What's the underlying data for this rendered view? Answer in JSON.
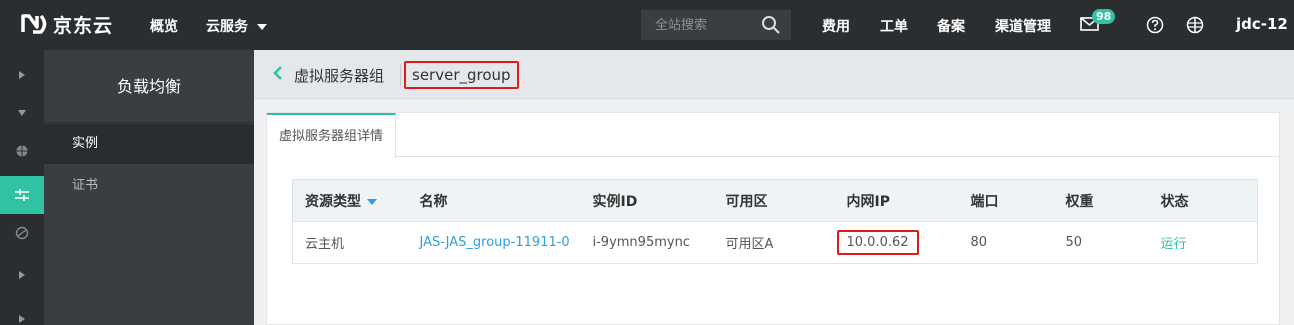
{
  "topbar": {
    "logo_text": "京东云",
    "nav": {
      "overview": "概览",
      "cloud_services": "云服务"
    },
    "search": {
      "placeholder": "全站搜索"
    },
    "links": {
      "billing": "费用",
      "tickets": "工单",
      "filing": "备案",
      "channel": "渠道管理"
    },
    "mail_badge": "98",
    "user": "jdc-12",
    "colors": {
      "background": "#2b2e31",
      "accent": "#2fc2a3"
    }
  },
  "rail": {
    "icons": [
      "chevron-right-icon",
      "chevron-down-icon",
      "globe-icon",
      "load-balancer-icon",
      "network-icon",
      "chevron-right-icon",
      "chevron-right-icon"
    ]
  },
  "sidebar": {
    "title": "负载均衡",
    "items": [
      {
        "label": "实例",
        "active": true
      },
      {
        "label": "证书",
        "active": false
      }
    ]
  },
  "breadcrumb": {
    "label": "虚拟服务器组",
    "name": "server_group"
  },
  "tabs": [
    {
      "label": "虚拟服务器组详情",
      "active": true
    }
  ],
  "table": {
    "headers": {
      "resource_type": "资源类型",
      "name": "名称",
      "instance_id": "实例ID",
      "zone": "可用区",
      "private_ip": "内网IP",
      "port": "端口",
      "weight": "权重",
      "status": "状态"
    },
    "rows": [
      {
        "resource_type": "云主机",
        "name": "JAS-JAS_group-11911-0",
        "instance_id": "i-9ymn95mync",
        "zone": "可用区A",
        "private_ip": "10.0.0.62",
        "port": "80",
        "weight": "50",
        "status": "运行"
      }
    ]
  },
  "colors": {
    "highlight_border": "#e01b1b",
    "link": "#2d9fe0",
    "status_running": "#2fc2a3"
  }
}
